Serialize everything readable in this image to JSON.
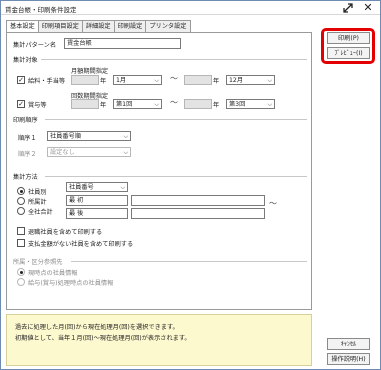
{
  "window": {
    "title": "賃金台帳・印刷条件設定",
    "resize_icon": "resize-arrows-icon",
    "close_icon": "close-icon"
  },
  "tabs": [
    "基本設定",
    "印刷項目設定",
    "詳細設定",
    "印刷設定",
    "プリンタ設定"
  ],
  "active_tab": 0,
  "pattern": {
    "label": "集計パターン名",
    "value": "賃金台帳"
  },
  "target": {
    "section_label": "集計対象",
    "period1_label": "月額期間指定",
    "period2_label": "回数期間指定",
    "salary": {
      "label": "給料・手当等",
      "checked": true,
      "from_year": "",
      "year_unit": "年",
      "from_month": "1月",
      "to_year": "",
      "to_month": "12月"
    },
    "bonus": {
      "label": "賞与等",
      "checked": true,
      "from_year": "",
      "year_unit": "年",
      "from_count": "第1回",
      "to_year": "",
      "to_count": "第3回"
    },
    "tilde": "〜"
  },
  "print_order": {
    "section_label": "印刷順序",
    "order1_label": "順序１",
    "order1_value": "社員番号順",
    "order2_label": "順序２",
    "order2_value": "設定なし"
  },
  "aggregation": {
    "section_label": "集計方法",
    "options": [
      "社員別",
      "所属計",
      "全社合計"
    ],
    "selected": 0,
    "key_select": "社員番号",
    "first_label": "最 初",
    "last_label": "最 後",
    "tilde": "〜"
  },
  "checks": {
    "retired": "退職社員を含めて印刷する",
    "no_pay": "支払金額がない社員を含めて印刷する"
  },
  "dept": {
    "section_label": "所属・区分参照先",
    "options": [
      "現時点の社員情報",
      "給与(賞与)処理時点の社員情報"
    ],
    "selected": 0
  },
  "buttons": {
    "print": "印刷(P)",
    "preview": "ﾌﾟﾚﾋﾞｭｰ(I)",
    "cancel": "ｷｬﾝｾﾙ",
    "help": "操作説明(H)"
  },
  "info": {
    "line1": "過去に処理した月(回)から現在処理月(回)を選択できます。",
    "line2": "初期値として、当年１月(回)〜現在処理月(回)が表示されます。"
  },
  "colors": {
    "highlight": "#e30000",
    "info_bg": "#fdf9cf"
  }
}
